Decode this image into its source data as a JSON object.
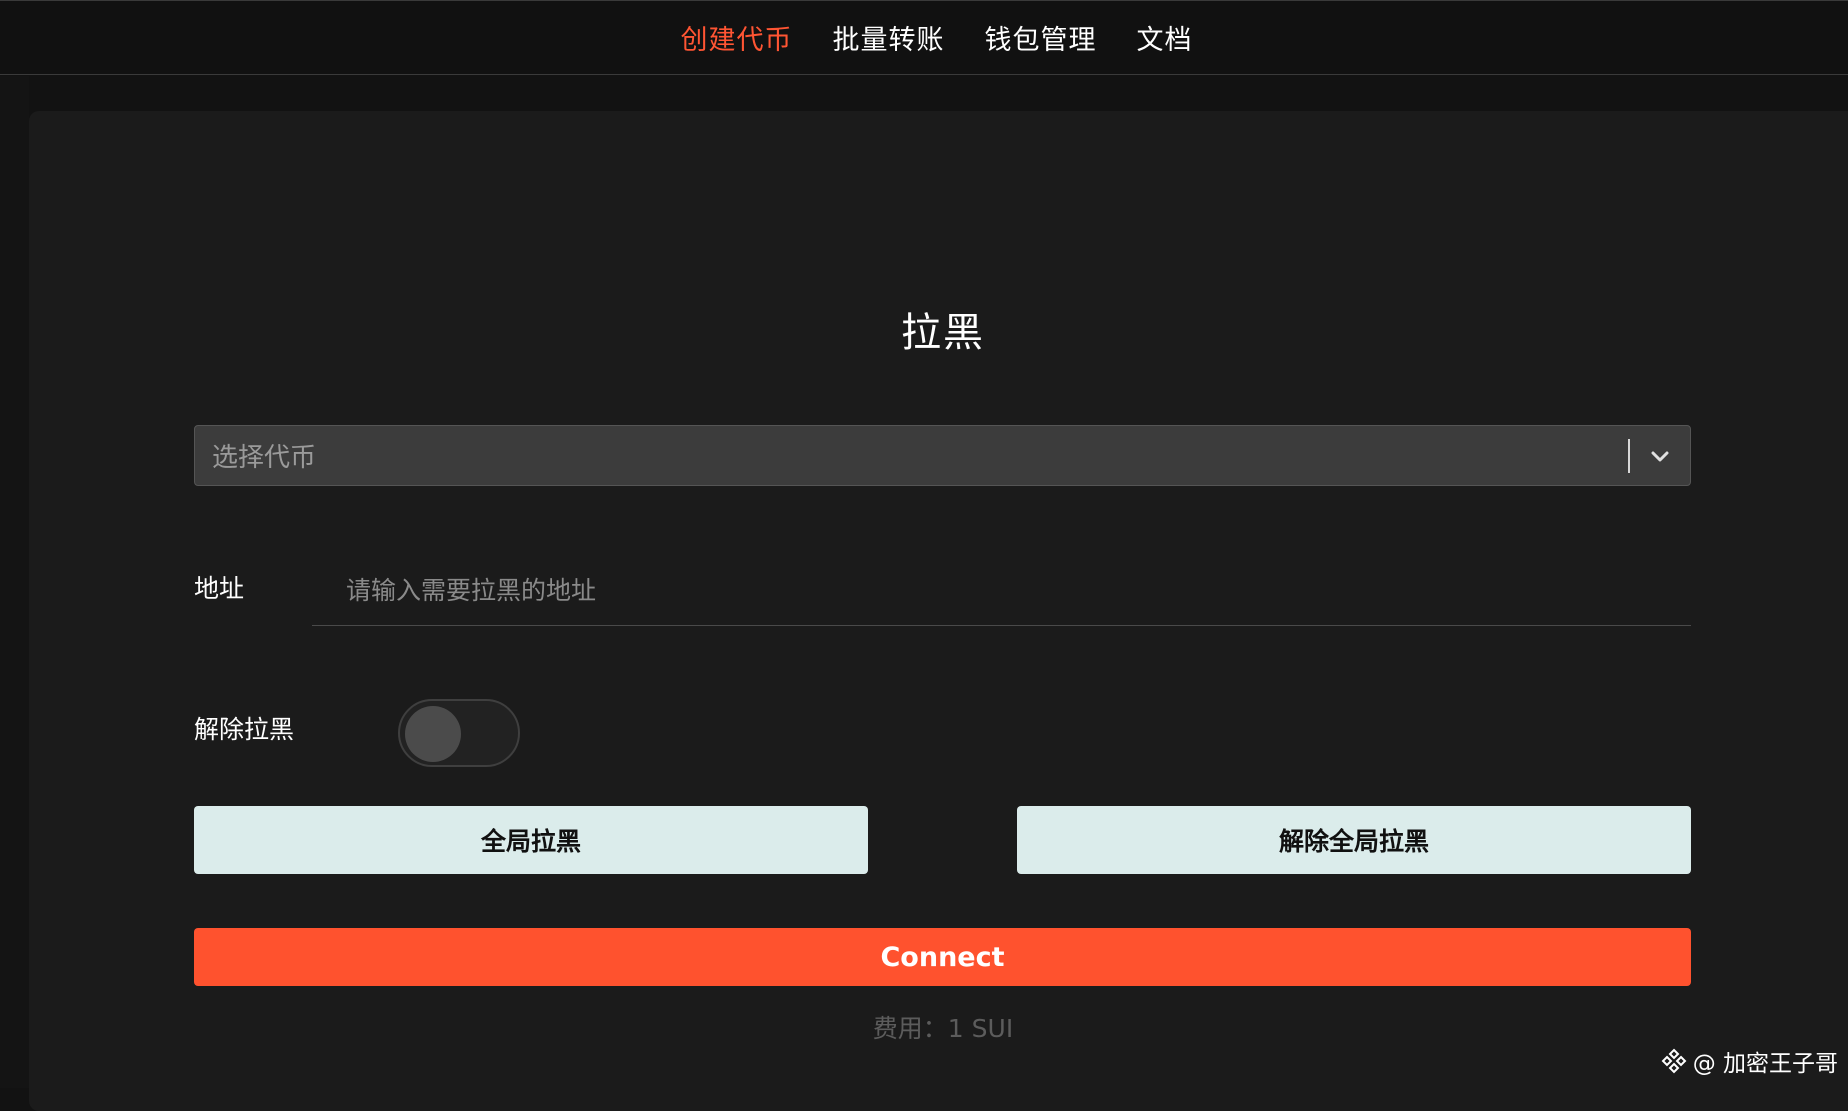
{
  "nav": {
    "items": [
      {
        "label": "创建代币",
        "active": true
      },
      {
        "label": "批量转账",
        "active": false
      },
      {
        "label": "钱包管理",
        "active": false
      },
      {
        "label": "文档",
        "active": false
      }
    ]
  },
  "form": {
    "title": "拉黑",
    "select_placeholder": "选择代币",
    "address_label": "地址",
    "address_placeholder": "请输入需要拉黑的地址",
    "address_value": "",
    "unblock_label": "解除拉黑",
    "unblock_on": false,
    "global_block_label": "全局拉黑",
    "global_unblock_label": "解除全局拉黑",
    "connect_label": "Connect",
    "fee_text": "费用：1 SUI"
  },
  "watermark": {
    "text": "@ 加密王子哥",
    "icon": "binance-diamond-icon"
  },
  "colors": {
    "accent": "#ff522e",
    "nav_active": "#ff5533",
    "button_light": "#dbeceb",
    "panel": "#1b1b1b"
  }
}
